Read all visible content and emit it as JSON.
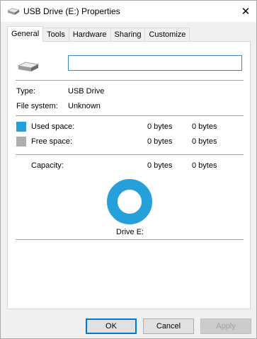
{
  "window": {
    "title": "USB Drive (E:) Properties",
    "close_glyph": "✕"
  },
  "tabs": [
    {
      "label": "General",
      "active": true
    },
    {
      "label": "Tools",
      "active": false
    },
    {
      "label": "Hardware",
      "active": false
    },
    {
      "label": "Sharing",
      "active": false
    },
    {
      "label": "Customize",
      "active": false
    }
  ],
  "general": {
    "name_value": "",
    "type_label": "Type:",
    "type_value": "USB Drive",
    "fs_label": "File system:",
    "fs_value": "Unknown",
    "used_label": "Used space:",
    "used_bytes": "0 bytes",
    "used_size": "0 bytes",
    "free_label": "Free space:",
    "free_bytes": "0 bytes",
    "free_size": "0 bytes",
    "capacity_label": "Capacity:",
    "capacity_bytes": "0 bytes",
    "capacity_size": "0 bytes",
    "drive_label": "Drive E:"
  },
  "colors": {
    "used": "#26a0da",
    "free": "#adadad",
    "ring": "#26a0da"
  },
  "icons": {
    "title": "usb-drive-icon",
    "drive": "usb-drive-icon",
    "close": "close-icon"
  },
  "buttons": {
    "ok": "OK",
    "cancel": "Cancel",
    "apply": "Apply"
  }
}
